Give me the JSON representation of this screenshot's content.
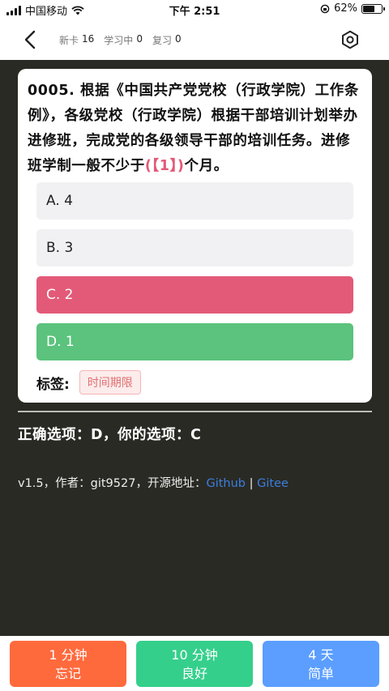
{
  "status_bar": {
    "carrier": "中国移动",
    "time": "下午 2:51",
    "battery": "62%",
    "battery_level": 0.62
  },
  "nav": {
    "new_label": "新卡",
    "new_count": "16",
    "learning_label": "学习中",
    "learning_count": "0",
    "review_label": "复习",
    "review_count": "0"
  },
  "question": {
    "text_before": "0005. 根据《中国共产党党校（行政学院）工作条例》，各级党校（行政学院）根据干部培训计划举办进修班，完成党的各级领导干部的培训任务。进修班学制一般不少于",
    "blank": "(【1】)",
    "text_after": "个月。"
  },
  "options": {
    "a": "A. 4",
    "b": "B. 3",
    "c": "C. 2",
    "d": "D. 1"
  },
  "tags": {
    "label": "标签:",
    "items": [
      "时间期限"
    ]
  },
  "answer": {
    "text": "正确选项：D，你的选项：C"
  },
  "footer": {
    "prefix": "v1.5，作者：git9527，开源地址：",
    "github": "Github",
    "separator": " | ",
    "gitee": "Gitee"
  },
  "buttons": {
    "forget_time": "1 分钟",
    "forget_label": "忘记",
    "good_time": "10 分钟",
    "good_label": "良好",
    "easy_time": "4 天",
    "easy_label": "简单"
  },
  "colors": {
    "wrong": "#e35a78",
    "correct": "#5bc37d",
    "forget": "#ff6a3d",
    "good": "#35cf8c",
    "easy": "#5b9eff",
    "link": "#3a7fdc",
    "background": "#2a2a25"
  }
}
